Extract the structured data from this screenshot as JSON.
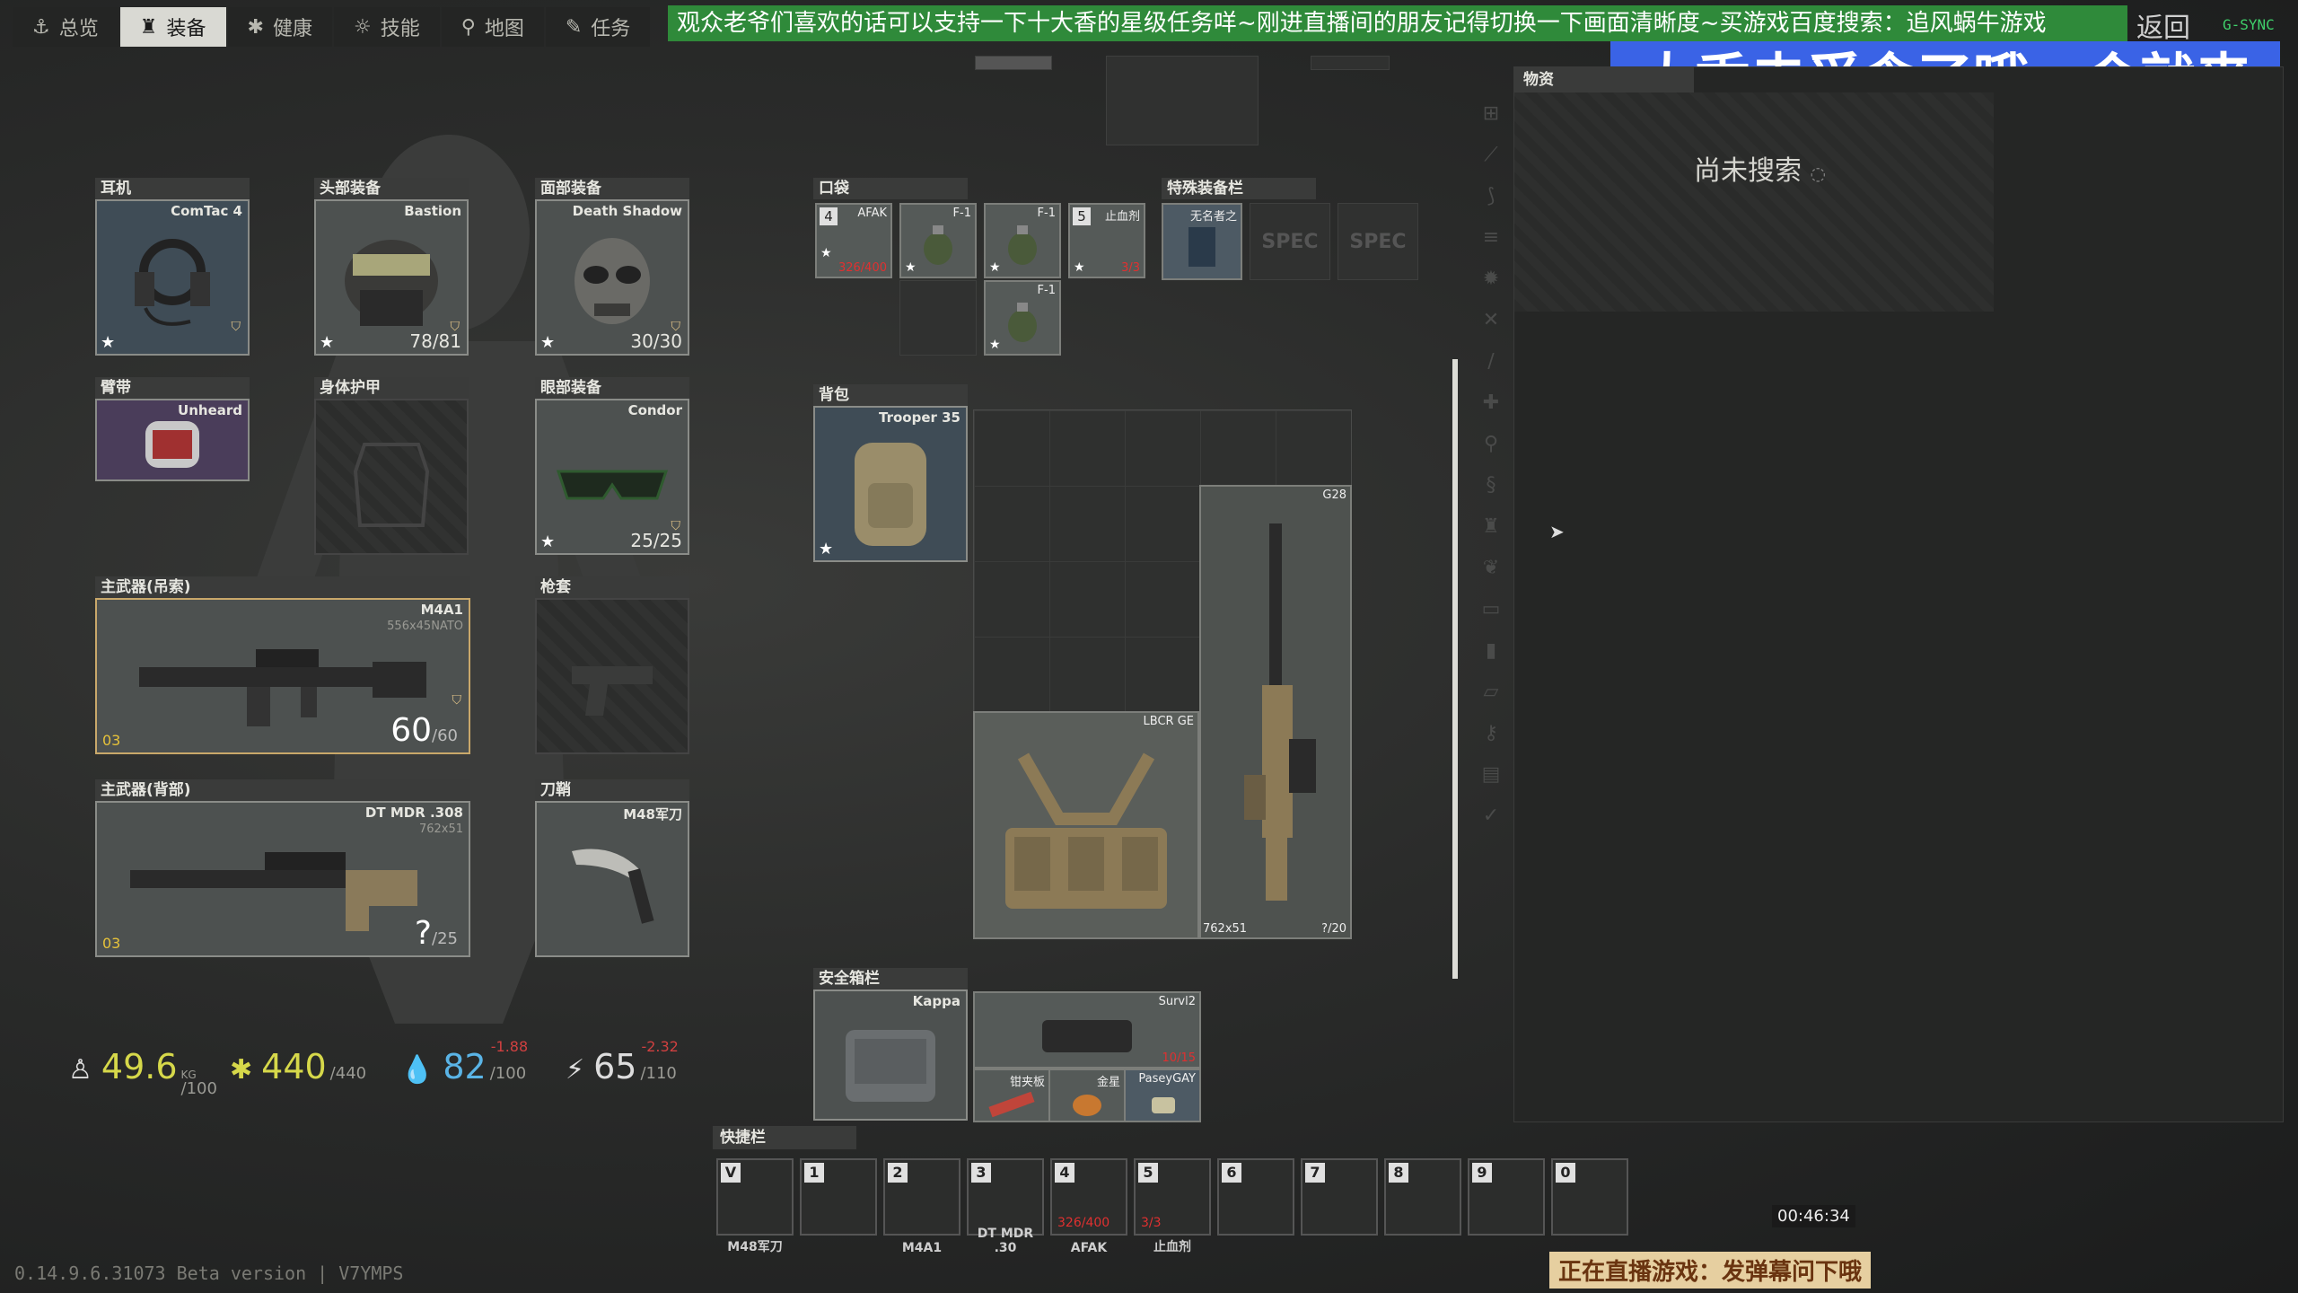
{
  "nav": {
    "tabs": [
      {
        "label": "总览",
        "icon": "anchor-icon"
      },
      {
        "label": "装备",
        "icon": "gear-icon"
      },
      {
        "label": "健康",
        "icon": "health-icon"
      },
      {
        "label": "技能",
        "icon": "skills-icon"
      },
      {
        "label": "地图",
        "icon": "map-pin-icon"
      },
      {
        "label": "任务",
        "icon": "tasks-icon"
      }
    ],
    "active_tab": "装备",
    "back_label": "返回"
  },
  "stream": {
    "banner": "观众老爷们喜欢的话可以支持一下十大香的星级任务咩~刚进直播间的朋友记得切换一下画面清晰度~买游戏百度搜索：追风蜗牛游戏",
    "overlay": "大香去觅食了哦一会就来",
    "gsync": "G-SYNC",
    "timer": "00:46:34",
    "bottom_notice": "正在直播游戏：发弹幕问下哦",
    "version": "0.14.9.6.31073 Beta version | V7YMPS"
  },
  "equipment": {
    "earpiece": {
      "header": "耳机",
      "item": "ComTac 4"
    },
    "headwear": {
      "header": "头部装备",
      "item": "Bastion",
      "durability": "78/81"
    },
    "faceCover": {
      "header": "面部装备",
      "item": "Death Shadow",
      "durability": "30/30"
    },
    "armband": {
      "header": "臂带",
      "item": "Unheard"
    },
    "bodyArmor": {
      "header": "身体护甲"
    },
    "eyewear": {
      "header": "眼部装备",
      "item": "Condor",
      "durability": "25/25"
    },
    "primary": {
      "header": "主武器(吊索)",
      "item": "M4A1",
      "caliber": "556x45NATO",
      "ammo": "60",
      "ammo_max": "/60",
      "rank": "03"
    },
    "holster": {
      "header": "枪套"
    },
    "secondary": {
      "header": "主武器(背部)",
      "item": "DT MDR .308",
      "caliber": "762x51",
      "ammo": "?",
      "ammo_max": "/25",
      "rank": "03"
    },
    "scabbard": {
      "header": "刀鞘",
      "item": "M48军刀"
    }
  },
  "pockets": {
    "header": "口袋",
    "items": [
      {
        "key": "4",
        "name": "AFAK",
        "count": "326/400"
      },
      {
        "key": "",
        "name": "F-1",
        "count": ""
      },
      {
        "key": "",
        "name": "F-1",
        "count": ""
      },
      {
        "key": "5",
        "name": "止血剂",
        "count": "3/3"
      },
      {
        "key": "",
        "name": "F-1",
        "count": ""
      }
    ]
  },
  "special": {
    "header": "特殊装备栏",
    "item": "无名者之",
    "spec_label": "SPEC"
  },
  "backpack": {
    "header": "背包",
    "item": "Trooper 35",
    "contents": [
      {
        "name": "G28",
        "caliber": "762x51",
        "ammo": "?/20"
      },
      {
        "name": "LBCR GE"
      }
    ]
  },
  "secure": {
    "header": "安全箱栏",
    "item": "Kappa",
    "contents": [
      {
        "name": "Survl2",
        "count": "10/15"
      },
      {
        "name": "钳夹板"
      },
      {
        "name": "金星"
      },
      {
        "name": "PaseyGAY"
      }
    ]
  },
  "loot": {
    "header": "物资",
    "status": "尚未搜索"
  },
  "stats": {
    "weight": "49.6",
    "weight_unit": "KG",
    "weight_max": "/100",
    "health": "440",
    "health_max": "/440",
    "hydration": "82",
    "hydration_max": "/100",
    "hydration_delta": "-1.88",
    "energy": "65",
    "energy_max": "/110",
    "energy_delta": "-2.32"
  },
  "quickbar": {
    "header": "快捷栏",
    "slots": [
      {
        "key": "V",
        "name": "M48军刀",
        "count": ""
      },
      {
        "key": "1",
        "name": "",
        "count": ""
      },
      {
        "key": "2",
        "name": "M4A1",
        "count": ""
      },
      {
        "key": "3",
        "name": "DT MDR .30",
        "count": ""
      },
      {
        "key": "4",
        "name": "AFAK",
        "count": "326/400"
      },
      {
        "key": "5",
        "name": "止血剂",
        "count": "3/3"
      },
      {
        "key": "6",
        "name": "",
        "count": ""
      },
      {
        "key": "7",
        "name": "",
        "count": ""
      },
      {
        "key": "8",
        "name": "",
        "count": ""
      },
      {
        "key": "9",
        "name": "",
        "count": ""
      },
      {
        "key": "0",
        "name": "",
        "count": ""
      }
    ]
  }
}
